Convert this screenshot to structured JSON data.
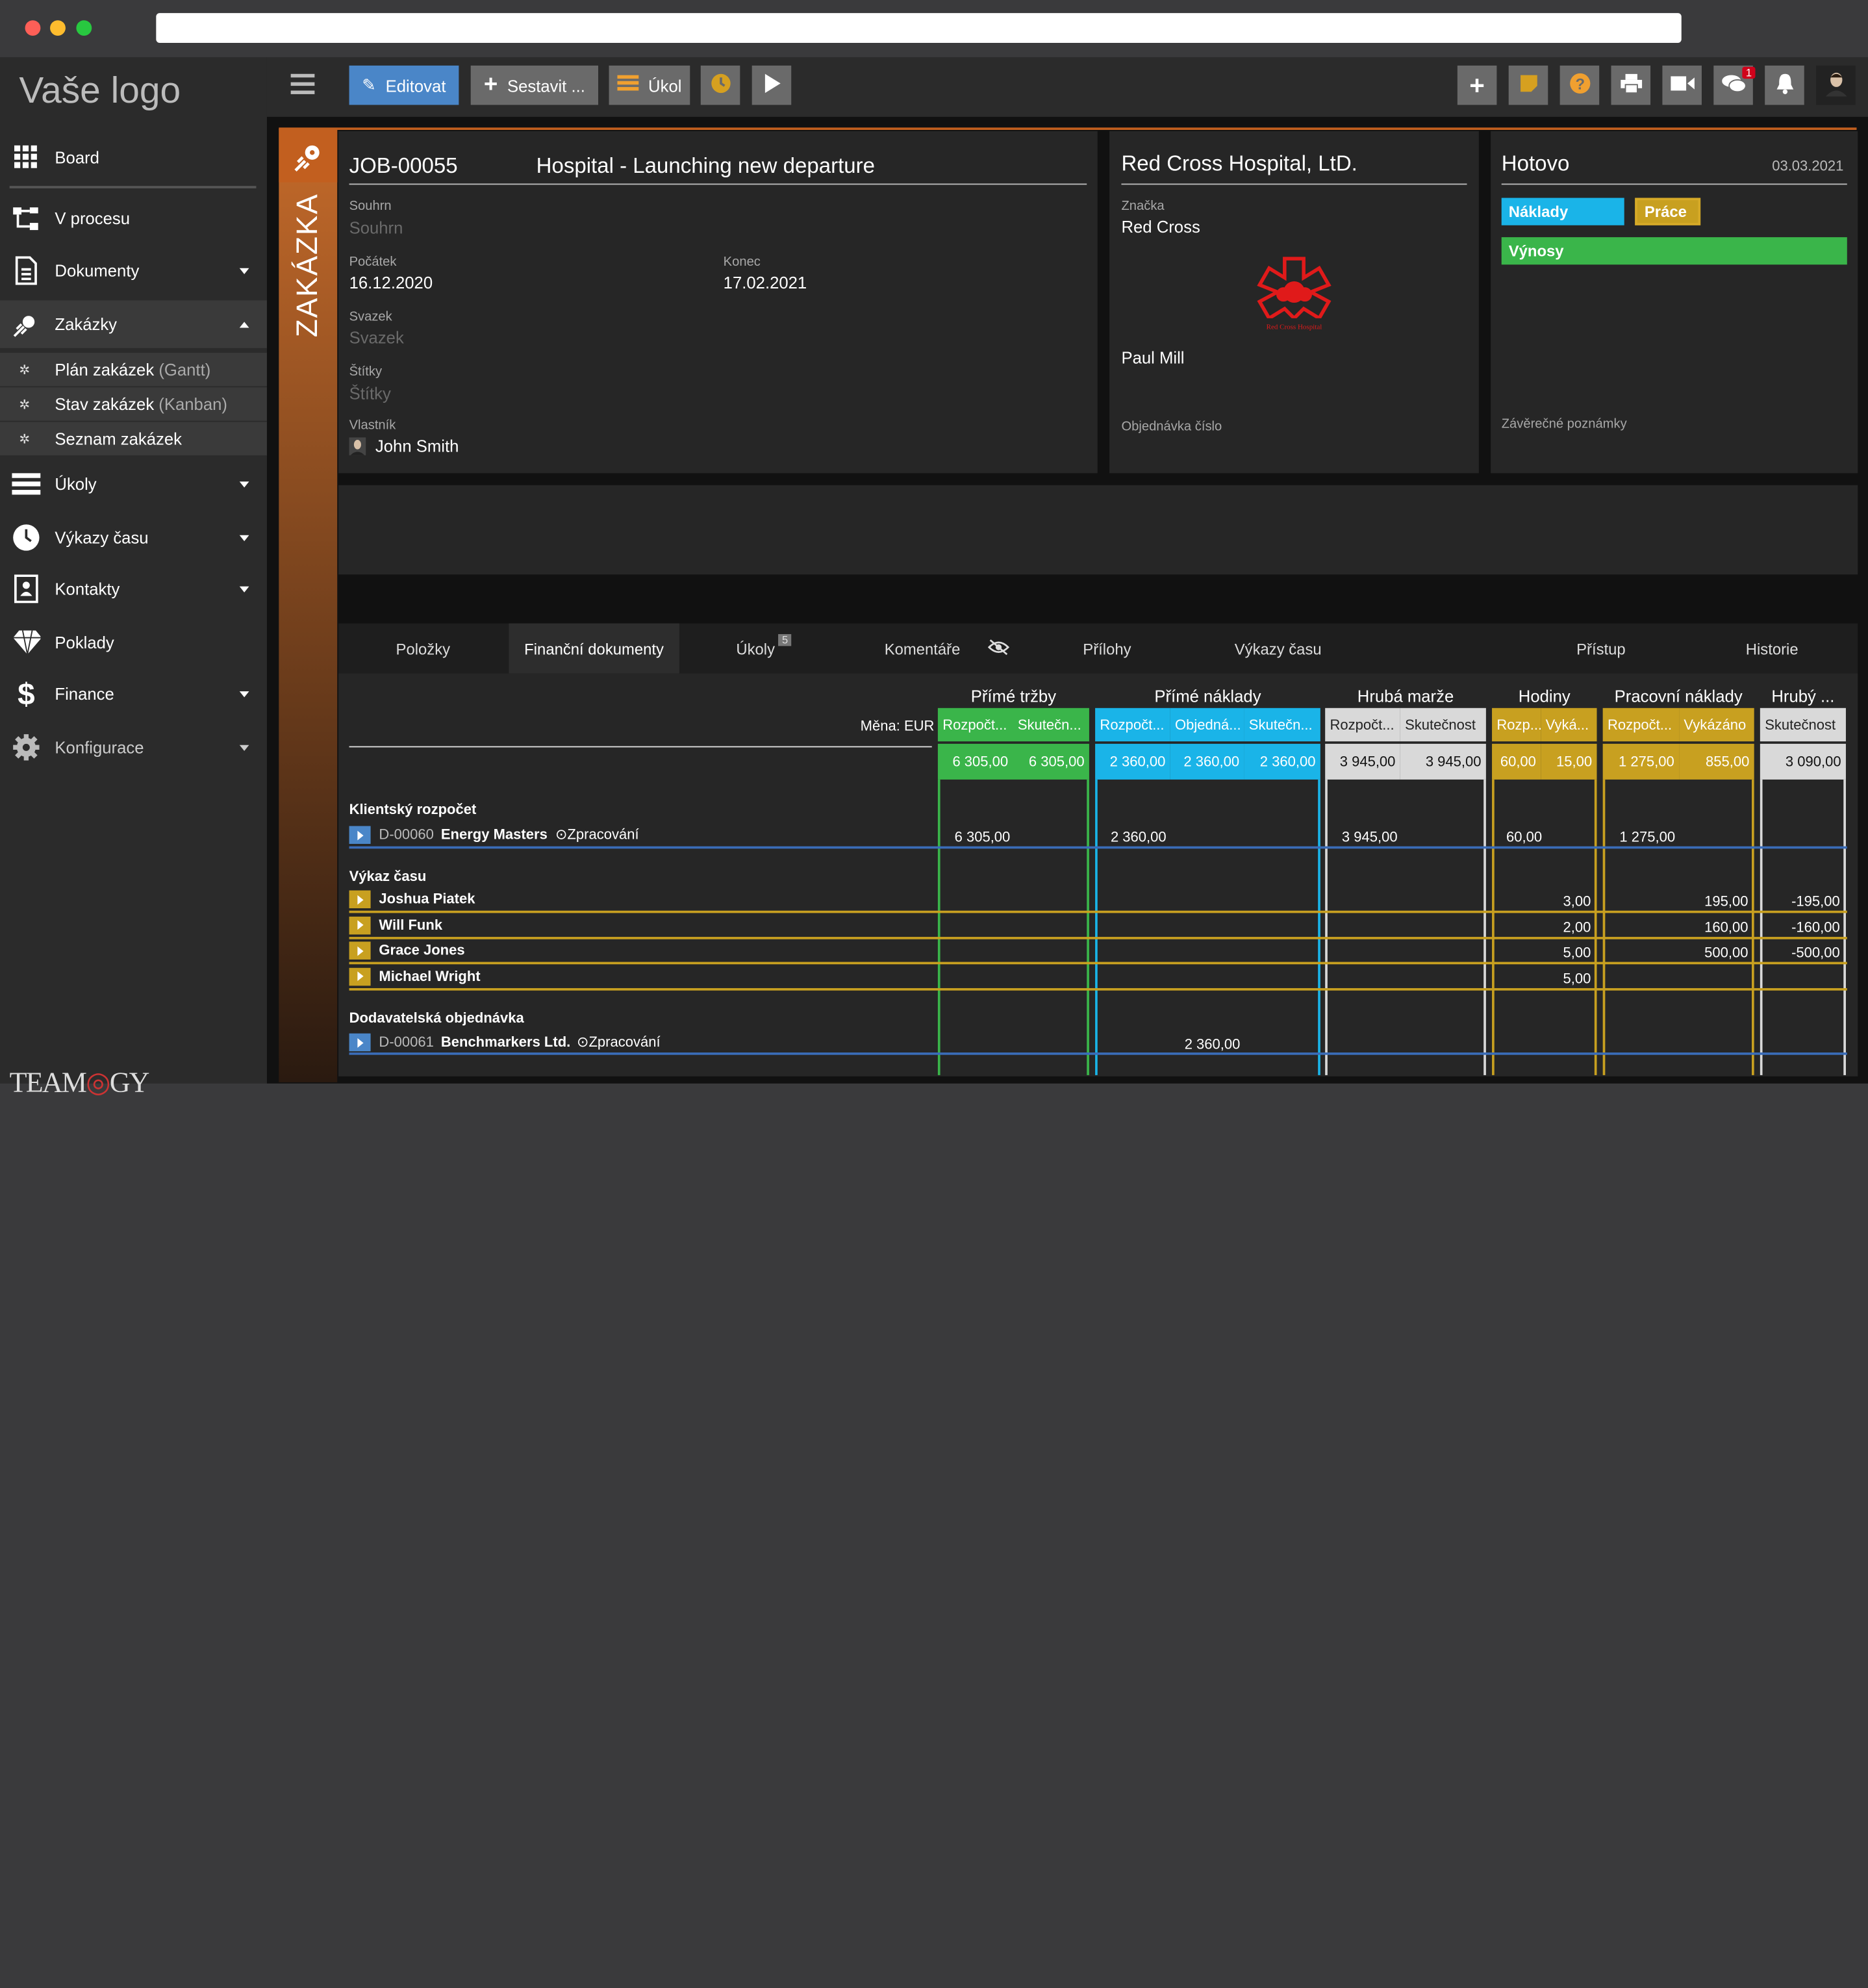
{
  "sidebar": {
    "logo": "Vaše logo",
    "items": [
      {
        "label": "Board"
      },
      {
        "label": "V procesu"
      },
      {
        "label": "Dokumenty"
      },
      {
        "label": "Zakázky"
      },
      {
        "label": "Úkoly"
      },
      {
        "label": "Výkazy času"
      },
      {
        "label": "Kontakty"
      },
      {
        "label": "Poklady"
      },
      {
        "label": "Finance"
      },
      {
        "label": "Konfigurace"
      }
    ],
    "sub": [
      {
        "label": "Plán zakázek",
        "hint": "(Gantt)"
      },
      {
        "label": "Stav zakázek",
        "hint": "(Kanban)"
      },
      {
        "label": "Seznam zakázek",
        "hint": ""
      }
    ],
    "brand": "TEAMOGY"
  },
  "toolbar": {
    "edit": "Editovat",
    "build": "Sestavit ...",
    "task": "Úkol",
    "chat_badge": "1"
  },
  "job": {
    "side_label": "ZAKÁZKA",
    "number": "JOB-00055",
    "name": "Hospital - Launching new departure",
    "summary_label": "Souhrn",
    "summary_ph": "Souhrn",
    "start_label": "Počátek",
    "start": "16.12.2020",
    "end_label": "Konec",
    "end": "17.02.2021",
    "bundle_label": "Svazek",
    "bundle_ph": "Svazek",
    "tags_label": "Štítky",
    "tags_ph": "Štítky",
    "owner_label": "Vlastník",
    "owner": "John Smith"
  },
  "client": {
    "name": "Red Cross Hospital, LtD.",
    "brand_label": "Značka",
    "brand": "Red Cross",
    "logo_caption": "Red Cross Hospital",
    "contact": "Paul Mill",
    "order_label": "Objednávka číslo"
  },
  "status": {
    "title": "Hotovo",
    "date": "03.03.2021",
    "costs": "Náklady",
    "work": "Práce",
    "revenue": "Výnosy",
    "notes_label": "Závěrečné poznámky",
    "colors": {
      "costs": "#1ab4e8",
      "work": "#c8a020",
      "revenue": "#3ab54a"
    }
  },
  "tabs": [
    {
      "label": "Položky"
    },
    {
      "label": "Finanční dokumenty"
    },
    {
      "label": "Úkoly",
      "badge": "5"
    },
    {
      "label": "Komentáře"
    },
    {
      "label": "Přílohy"
    },
    {
      "label": "Výkazy času"
    },
    {
      "label": "Přístup"
    },
    {
      "label": "Historie"
    }
  ],
  "grid": {
    "currency": "Měna: EUR",
    "groups": [
      "Přímé tržby",
      "Přímé náklady",
      "Hrubá marže",
      "Hodiny",
      "Pracovní náklady",
      "Hrubý ..."
    ],
    "subheads": [
      "Rozpočt...",
      "Skutečn...",
      "Rozpočt...",
      "Objedná...",
      "Skutečn...",
      "Rozpočt...",
      "Skutečnost",
      "Rozp...",
      "Vyká...",
      "Rozpočt...",
      "Vykázáno",
      "Skutečnost"
    ],
    "totals": [
      "6 305,00",
      "6 305,00",
      "2 360,00",
      "2 360,00",
      "2 360,00",
      "3 945,00",
      "3 945,00",
      "60,00",
      "15,00",
      "1 275,00",
      "855,00",
      "3 090,00"
    ],
    "sections": {
      "budget": "Klientský rozpočet",
      "timesheet": "Výkaz času",
      "supplier": "Dodavatelská objednávka"
    },
    "budget_row": {
      "code": "D-00060",
      "name": "Energy Masters",
      "state": "Zpracování",
      "v1": "6 305,00",
      "v2": "2 360,00",
      "v3": "3 945,00",
      "v4": "60,00",
      "v5": "1 275,00"
    },
    "people": [
      {
        "name": "Joshua Piatek",
        "hours": "3,00",
        "cost": "195,00",
        "margin": "-195,00"
      },
      {
        "name": "Will Funk",
        "hours": "2,00",
        "cost": "160,00",
        "margin": "-160,00"
      },
      {
        "name": "Grace Jones",
        "hours": "5,00",
        "cost": "500,00",
        "margin": "-500,00"
      },
      {
        "name": "Michael Wright",
        "hours": "5,00",
        "cost": "",
        "margin": ""
      }
    ],
    "supplier_row": {
      "code": "D-00061",
      "name": "Benchmarkers Ltd.",
      "state": "Zpracování",
      "v": "2 360,00"
    }
  }
}
